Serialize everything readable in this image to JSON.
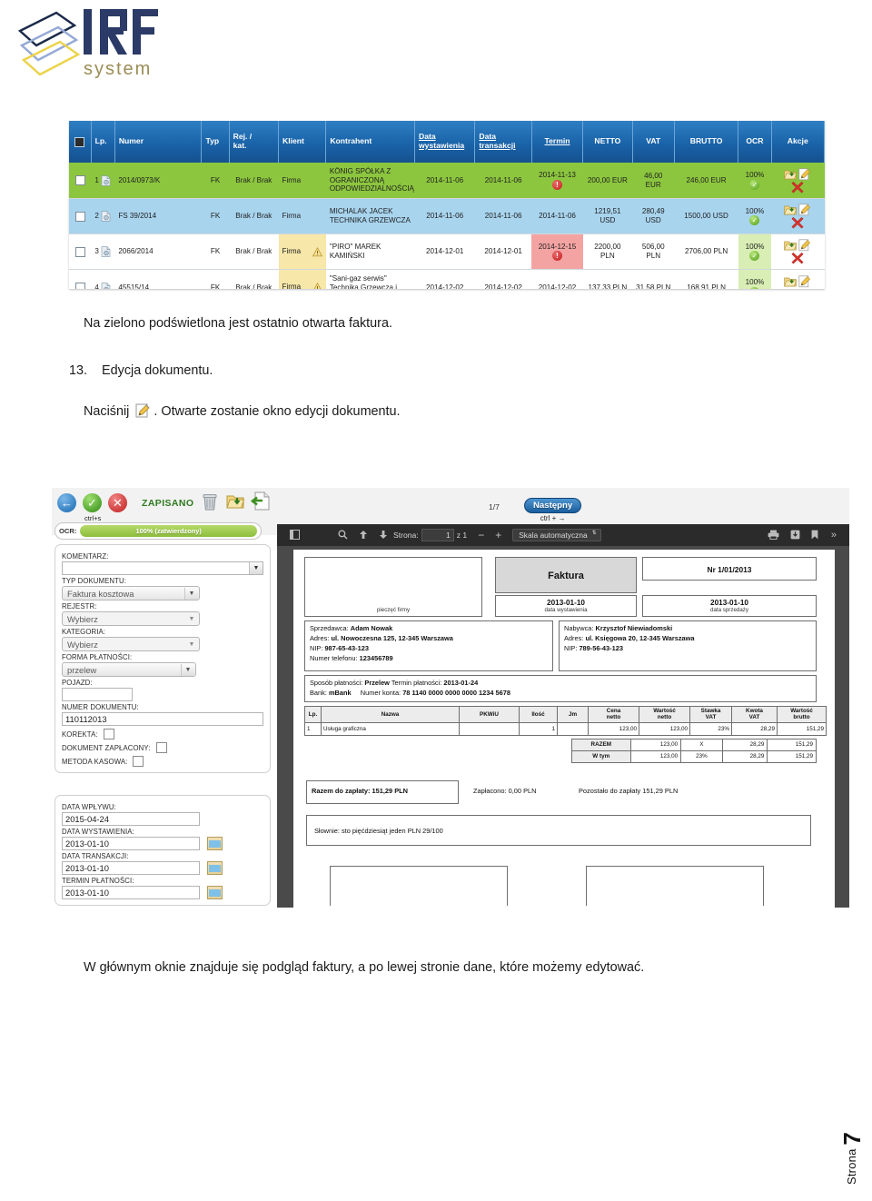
{
  "logo": {
    "brand": "IRF",
    "sub": "system"
  },
  "invoice_list": {
    "columns": [
      "",
      "Lp.",
      "Numer",
      "Typ",
      "Rej. / kat.",
      "Klient",
      "Kontrahent",
      "Data wystawienia",
      "Data transakcji",
      "Termin",
      "NETTO",
      "VAT",
      "BRUTTO",
      "OCR",
      "Akcje"
    ],
    "rows": [
      {
        "lp": "1",
        "numer": "2014/0973/K",
        "typ": "FK",
        "rej": "Brak / Brak",
        "klient": "Firma",
        "kontrahent": "KÖNIG SPÓŁKA Z OGRANICZONĄ ODPOWIEDZIALNOŚCIĄ",
        "data_wystawienia": "2014-11-06",
        "data_transakcji": "2014-11-06",
        "termin": "2014-11-13",
        "netto": "200,00 EUR",
        "vat": "46,00 EUR",
        "brutto": "246,00 EUR",
        "ocr": "100%",
        "highlight": "green",
        "termin_late": true,
        "warn": false
      },
      {
        "lp": "2",
        "numer": "FS 39/2014",
        "typ": "FK",
        "rej": "Brak / Brak",
        "klient": "Firma",
        "kontrahent": "MICHALAK JACEK TECHNIKA GRZEWCZA",
        "data_wystawienia": "2014-11-06",
        "data_transakcji": "2014-11-06",
        "termin": "2014-11-06",
        "netto": "1219,51 USD",
        "vat": "280,49 USD",
        "brutto": "1500,00 USD",
        "ocr": "100%",
        "highlight": "blue",
        "termin_late": false,
        "warn": false
      },
      {
        "lp": "3",
        "numer": "2066/2014",
        "typ": "FK",
        "rej": "Brak / Brak",
        "klient": "Firma",
        "kontrahent": "\"PIRO\" MAREK KAMIŃSKI",
        "data_wystawienia": "2014-12-01",
        "data_transakcji": "2014-12-01",
        "termin": "2014-12-15",
        "netto": "2200,00 PLN",
        "vat": "506,00 PLN",
        "brutto": "2706,00 PLN",
        "ocr": "100%",
        "highlight": "white",
        "termin_late": true,
        "warn": true
      },
      {
        "lp": "4",
        "numer": "45515/14",
        "typ": "FK",
        "rej": "Brak / Brak",
        "klient": "Firma",
        "kontrahent": "\"Sani-gaz serwis\" Technika Grzewcza i Sanitarna Mariusz Krupa",
        "data_wystawienia": "2014-12-02",
        "data_transakcji": "2014-12-02",
        "termin": "2014-12-02",
        "netto": "137,33 PLN",
        "vat": "31,58 PLN",
        "brutto": "168,91 PLN",
        "ocr": "100%",
        "highlight": "white",
        "termin_late": false,
        "warn": true
      }
    ]
  },
  "body": {
    "note_green": "Na zielono podświetlona jest ostatnio otwarta faktura.",
    "step_number": "13.",
    "step_title": "Edycja dokumentu.",
    "press_prefix": "Naciśnij",
    "press_suffix": ". Otwarte zostanie okno edycji dokumentu.",
    "closing": "W głównym oknie znajduje się podgląd faktury, a po lewej stronie dane, które możemy edytować."
  },
  "editor": {
    "toolbar": {
      "back_cap": "",
      "save_cap": "ctrl+s",
      "saved_label": "ZAPISANO",
      "page_counter": "1/7",
      "next_label": "Następny",
      "next_cap": "ctrl + →"
    },
    "ocr": {
      "label": "OCR:",
      "value": "100% (zatwierdzony)"
    },
    "form": {
      "komentarz_label": "KOMENTARZ:",
      "komentarz_value": "",
      "typ_dokumentu_label": "TYP DOKUMENTU:",
      "typ_dokumentu_value": "Faktura kosztowa",
      "rejestr_label": "REJESTR:",
      "rejestr_value": "Wybierz",
      "kategoria_label": "KATEGORIA:",
      "kategoria_value": "Wybierz",
      "forma_platnosci_label": "FORMA PŁATNOŚCI:",
      "forma_platnosci_value": "przelew",
      "pojazd_label": "POJAZD:",
      "pojazd_value": "",
      "numer_dokumentu_label": "NUMER DOKUMENTU:",
      "numer_dokumentu_value": "110112013",
      "korekta_label": "KOREKTA:",
      "dokument_zaplacony_label": "DOKUMENT ZAPŁACONY:",
      "metoda_kasowa_label": "METODA KASOWA:",
      "data_wplywu_label": "DATA WPŁYWU:",
      "data_wplywu_value": "2015-04-24",
      "data_wystawienia_label": "DATA WYSTAWIENIA:",
      "data_wystawienia_value": "2013-01-10",
      "data_transakcji_label": "DATA TRANSAKCJI:",
      "data_transakcji_value": "2013-01-10",
      "termin_platnosci_label": "TERMIN PŁATNOŚCI:",
      "termin_platnosci_value": "2013-01-10"
    },
    "pdfbar": {
      "page_label": "Strona:",
      "page_value": "1",
      "page_of": "z 1",
      "zoom_out": "−",
      "zoom_in": "+",
      "scale_value": "Skala automatyczna"
    }
  },
  "preview_invoice": {
    "stamp_caption": "pieczęć firmy",
    "title": "Faktura",
    "number": "Nr 1/01/2013",
    "issue_date": "2013-01-10",
    "issue_date_caption": "data wystawienia",
    "sale_date": "2013-01-10",
    "sale_date_caption": "data sprzedaży",
    "seller": {
      "name_label": "Sprzedawca:",
      "name": "Adam Nowak",
      "address_label": "Adres:",
      "address": "ul. Nowoczesna 125, 12-345 Warszawa",
      "nip_label": "NIP:",
      "nip": "987-65-43-123",
      "phone_label": "Numer telefonu:",
      "phone": "123456789"
    },
    "buyer": {
      "name_label": "Nabywca:",
      "name": "Krzysztof Niewiadomski",
      "address_label": "Adres:",
      "address": "ul. Księgowa 20, 12-345 Warszawa",
      "nip_label": "NIP:",
      "nip": "789-56-43-123"
    },
    "payment": {
      "method_label": "Sposób płatności:",
      "method": "Przelew",
      "term_label": "Termin płatności:",
      "term": "2013-01-24",
      "bank_label": "Bank:",
      "bank": "mBank",
      "account_label": "Numer konta:",
      "account": "78 1140 0000 0000 0000 1234 5678"
    },
    "items_header": [
      "Lp.",
      "Nazwa",
      "PKWiU",
      "Ilość",
      "Jm",
      "Cena netto",
      "Wartość netto",
      "Stawka VAT",
      "Kwota VAT",
      "Wartość brutto"
    ],
    "items": [
      {
        "lp": "1",
        "nazwa": "Usługa graficzna",
        "pkwiu": "",
        "ilosc": "1",
        "jm": "",
        "cena_netto": "123,00",
        "wartosc_netto": "123,00",
        "stawka_vat": "23%",
        "kwota_vat": "28,29",
        "wartosc_brutto": "151,29"
      }
    ],
    "totals": [
      {
        "label": "RAZEM",
        "netto": "123,00",
        "stawka": "X",
        "vat": "28,29",
        "brutto": "151,29"
      },
      {
        "label": "W tym",
        "netto": "123,00",
        "stawka": "23%",
        "vat": "28,29",
        "brutto": "151,29"
      }
    ],
    "total_due_label": "Razem do zapłaty:",
    "total_due": "151,29 PLN",
    "paid_label": "Zapłacono:",
    "paid": "0,00 PLN",
    "remaining_label": "Pozostało do zapłaty",
    "remaining": "151,29 PLN",
    "in_words": "Słownie: sto pięćdziesiąt jeden PLN 29/100"
  },
  "footer": {
    "page_label": "Strona",
    "page_number": "7"
  }
}
